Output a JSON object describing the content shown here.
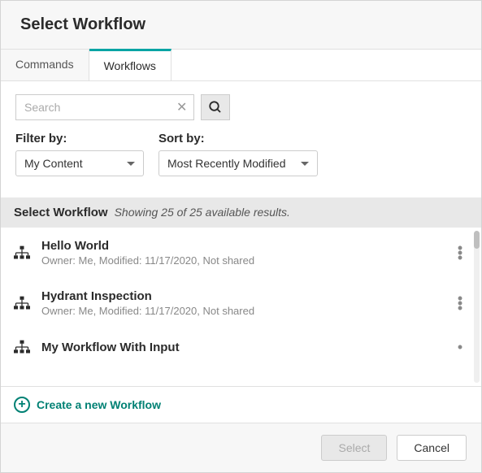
{
  "header": {
    "title": "Select Workflow"
  },
  "tabs": {
    "commands": "Commands",
    "workflows": "Workflows"
  },
  "search": {
    "placeholder": "Search"
  },
  "filters": {
    "filter_label": "Filter by:",
    "filter_value": "My Content",
    "sort_label": "Sort by:",
    "sort_value": "Most Recently Modified"
  },
  "results": {
    "title": "Select Workflow",
    "count_text": "Showing 25 of 25 available results."
  },
  "items": [
    {
      "title": "Hello World",
      "meta": "Owner: Me, Modified: 11/17/2020, Not shared"
    },
    {
      "title": "Hydrant Inspection",
      "meta": "Owner: Me, Modified: 11/17/2020, Not shared"
    },
    {
      "title": "My Workflow With Input",
      "meta": ""
    }
  ],
  "create": {
    "label": "Create a new Workflow"
  },
  "footer": {
    "select": "Select",
    "cancel": "Cancel"
  }
}
